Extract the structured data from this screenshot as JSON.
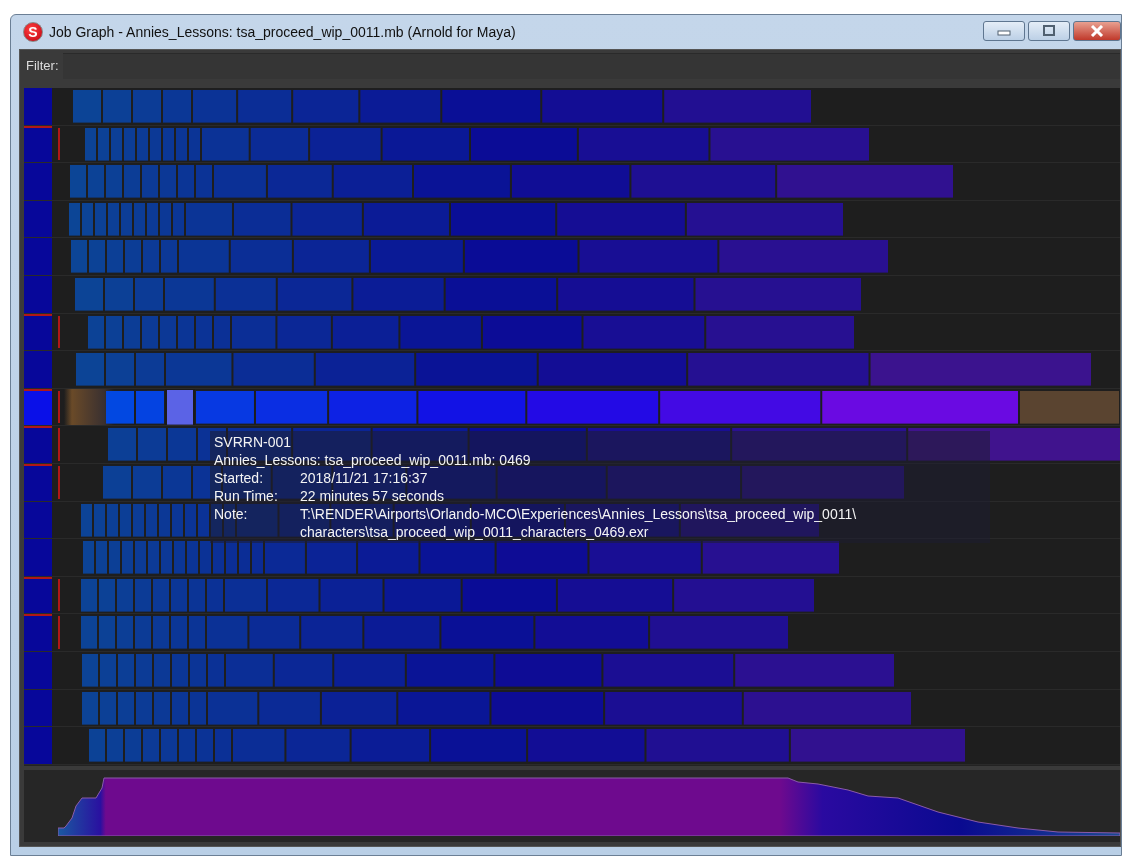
{
  "window": {
    "app_icon": "S",
    "title": "Job Graph - Annies_Lessons: tsa_proceed_wip_0011.mb (Arnold for Maya)"
  },
  "filter": {
    "label": "Filter:"
  },
  "rows": [
    {
      "selected": false,
      "flagged": false
    },
    {
      "selected": false,
      "flagged": true
    },
    {
      "selected": false,
      "flagged": false
    },
    {
      "selected": false,
      "flagged": false
    },
    {
      "selected": false,
      "flagged": false
    },
    {
      "selected": false,
      "flagged": false
    },
    {
      "selected": false,
      "flagged": true
    },
    {
      "selected": false,
      "flagged": false
    },
    {
      "selected": true,
      "flagged": true
    },
    {
      "selected": false,
      "flagged": true
    },
    {
      "selected": false,
      "flagged": true
    },
    {
      "selected": false,
      "flagged": false
    },
    {
      "selected": false,
      "flagged": false
    },
    {
      "selected": false,
      "flagged": true
    },
    {
      "selected": false,
      "flagged": true
    },
    {
      "selected": false,
      "flagged": false
    },
    {
      "selected": false,
      "flagged": false
    },
    {
      "selected": false,
      "flagged": false
    }
  ],
  "tooltip": {
    "host": "SVRRN-001",
    "job": "Annies_Lessons: tsa_proceed_wip_0011.mb: 0469",
    "fields": [
      {
        "label": "Started:",
        "value": "2018/11/21 17:16:37"
      },
      {
        "label": "Run Time:",
        "value": "22 minutes 57 seconds"
      },
      {
        "label": "Note:",
        "value": "T:\\RENDER\\Airports\\Orlando-MCO\\Experiences\\Annies_Lessons\\tsa_proceed_wip_0011\\"
      }
    ],
    "note_continued": "characters\\tsa_proceed_wip_0011_characters_0469.exr"
  }
}
